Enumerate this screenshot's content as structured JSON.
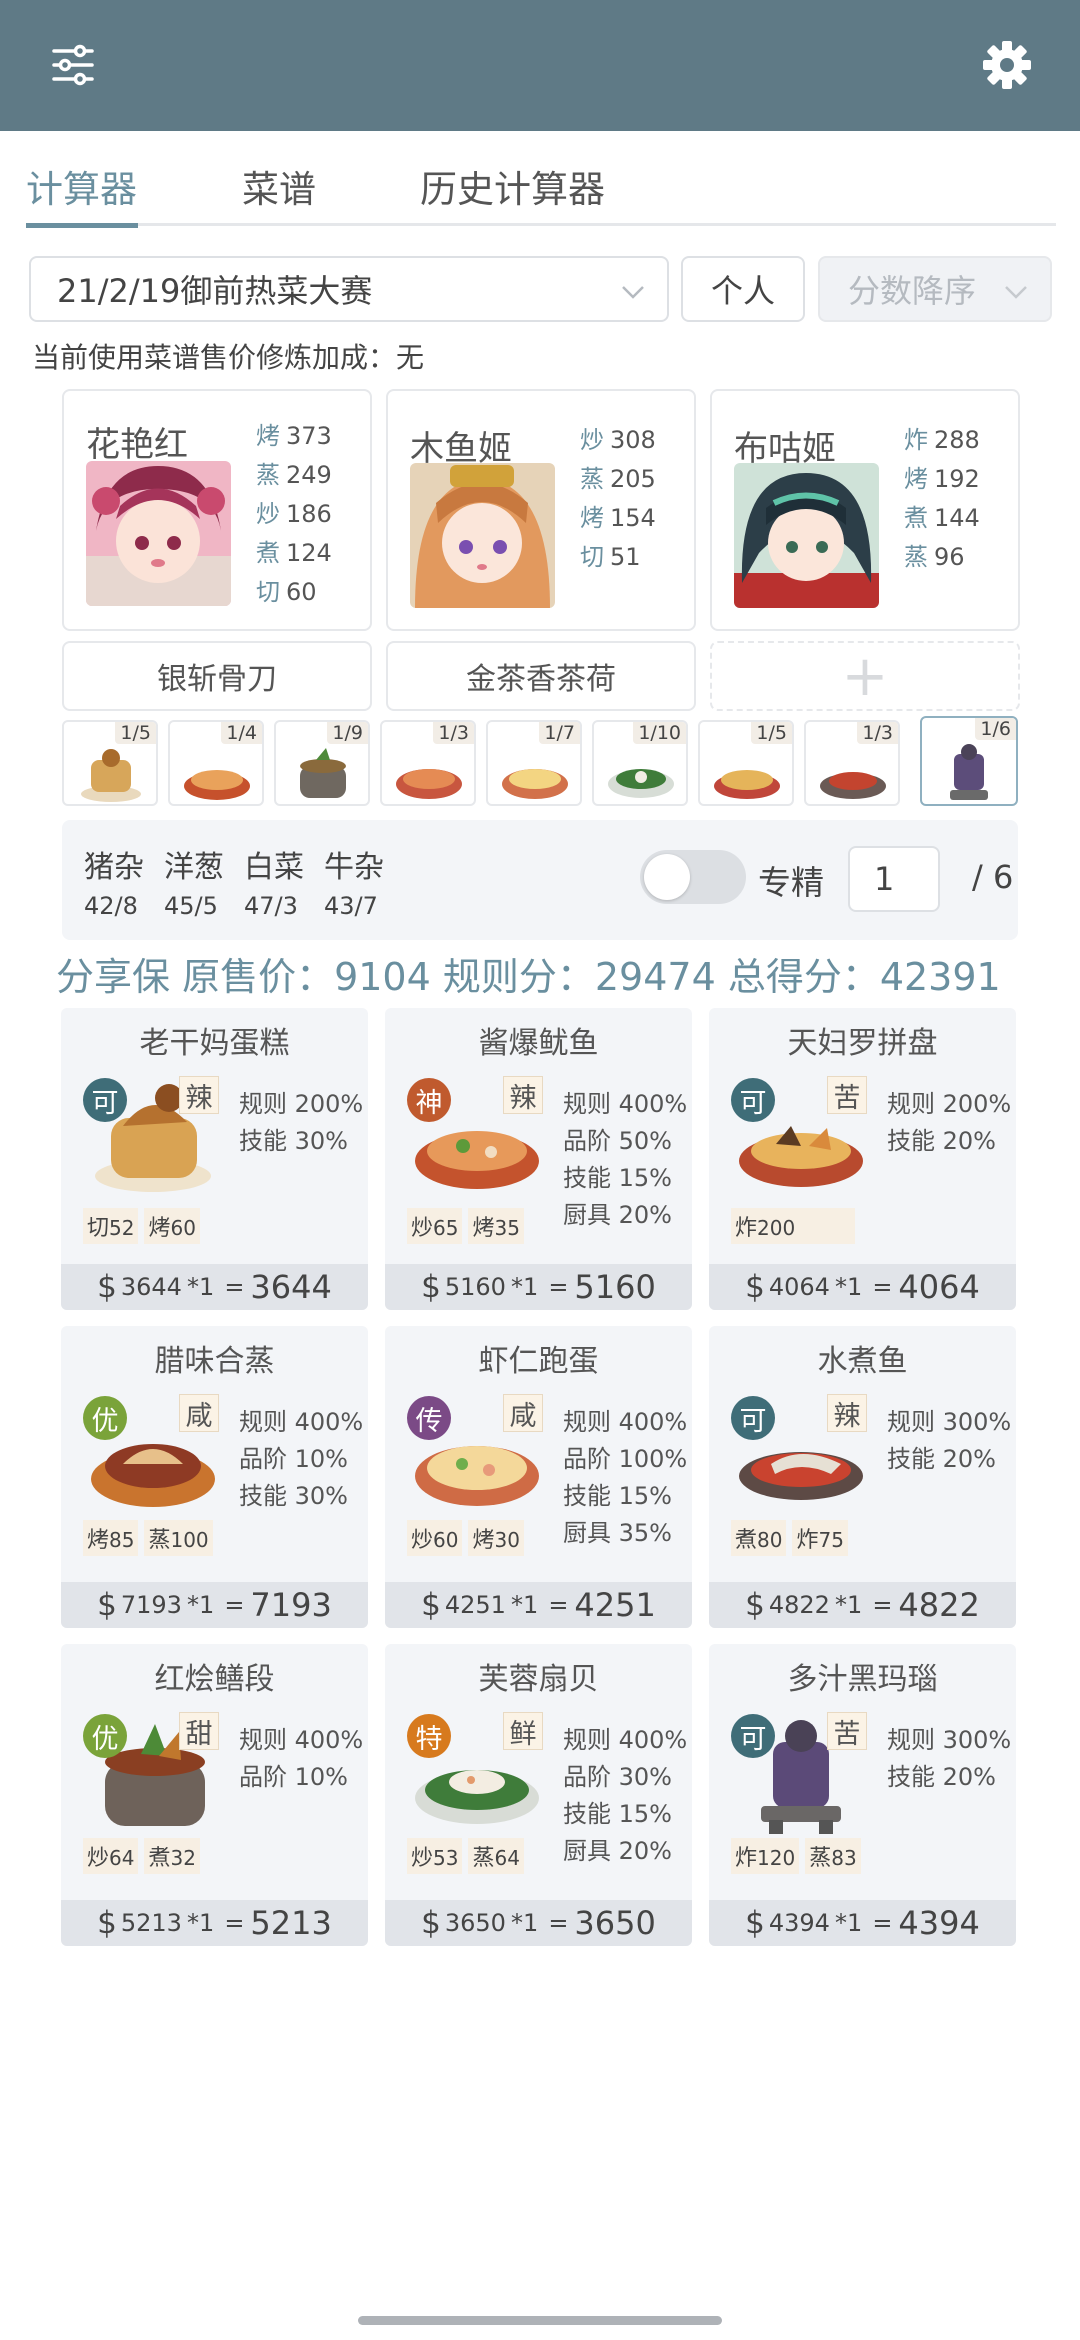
{
  "header": {
    "filter_icon": "sliders-icon",
    "settings_icon": "gear-icon",
    "bar_color": "#5f7a86"
  },
  "tabs": [
    {
      "label": "计算器",
      "active": true
    },
    {
      "label": "菜谱",
      "active": false
    },
    {
      "label": "历史计算器",
      "active": false
    }
  ],
  "controls": {
    "contest": "21/2/19御前热菜大赛",
    "mode": "个人",
    "sort": "分数降序"
  },
  "bonus_line": "当前使用菜谱售价修炼加成：无",
  "chefs": [
    {
      "name": "花艳红",
      "skills": [
        {
          "k": "烤",
          "v": "373"
        },
        {
          "k": "蒸",
          "v": "249"
        },
        {
          "k": "炒",
          "v": "186"
        },
        {
          "k": "煮",
          "v": "124"
        },
        {
          "k": "切",
          "v": "60"
        }
      ]
    },
    {
      "name": "木鱼姬",
      "skills": [
        {
          "k": "炒",
          "v": "308"
        },
        {
          "k": "蒸",
          "v": "205"
        },
        {
          "k": "烤",
          "v": "154"
        },
        {
          "k": "切",
          "v": "51"
        }
      ]
    },
    {
      "name": "布咕姬",
      "skills": [
        {
          "k": "炸",
          "v": "288"
        },
        {
          "k": "烤",
          "v": "192"
        },
        {
          "k": "煮",
          "v": "144"
        },
        {
          "k": "蒸",
          "v": "96"
        }
      ]
    }
  ],
  "equipment": [
    "银斩骨刀",
    "金茶香茶荷",
    "+"
  ],
  "thumb_counts": [
    "1/5",
    "1/4",
    "1/9",
    "1/3",
    "1/7",
    "1/10",
    "1/5",
    "1/3",
    "1/6"
  ],
  "ingredients": [
    {
      "name": "猪杂",
      "value": "42/8"
    },
    {
      "name": "洋葱",
      "value": "45/5"
    },
    {
      "name": "白菜",
      "value": "47/3"
    },
    {
      "name": "牛杂",
      "value": "43/7"
    }
  ],
  "specialize": {
    "label": "专精",
    "qty": "1",
    "max": "/ 6",
    "on": false
  },
  "score_line": "分享保 原售价：9104 规则分：29474 总得分：42391",
  "dishes": [
    {
      "name": "老干妈蛋糕",
      "rarity": "可",
      "rarity_color": "#3f6d78",
      "flavor": "辣",
      "bonuses": [
        "规则 200%",
        "技能 30%"
      ],
      "reqs": [
        {
          "k": "切",
          "v": "52"
        },
        {
          "k": "烤",
          "v": "60"
        }
      ],
      "price": "3644",
      "mult": "*1",
      "total": "3644"
    },
    {
      "name": "酱爆鱿鱼",
      "rarity": "神",
      "rarity_color": "#c05a2e",
      "flavor": "辣",
      "bonuses": [
        "规则 400%",
        "品阶 50%",
        "技能 15%",
        "厨具 20%"
      ],
      "reqs": [
        {
          "k": "炒",
          "v": "65"
        },
        {
          "k": "烤",
          "v": "35"
        }
      ],
      "price": "5160",
      "mult": "*1",
      "total": "5160"
    },
    {
      "name": "天妇罗拼盘",
      "rarity": "可",
      "rarity_color": "#3f6d78",
      "flavor": "苦",
      "bonuses": [
        "规则 200%",
        "技能 20%"
      ],
      "reqs": [
        {
          "k": "炸",
          "v": "200"
        }
      ],
      "price": "4064",
      "mult": "*1",
      "total": "4064"
    },
    {
      "name": "腊味合蒸",
      "rarity": "优",
      "rarity_color": "#7aa33a",
      "flavor": "咸",
      "bonuses": [
        "规则 400%",
        "品阶 10%",
        "技能 30%"
      ],
      "reqs": [
        {
          "k": "烤",
          "v": "85"
        },
        {
          "k": "蒸",
          "v": "100"
        }
      ],
      "price": "7193",
      "mult": "*1",
      "total": "7193"
    },
    {
      "name": "虾仁跑蛋",
      "rarity": "传",
      "rarity_color": "#7b4a86",
      "flavor": "咸",
      "bonuses": [
        "规则 400%",
        "品阶 100%",
        "技能 15%",
        "厨具 35%"
      ],
      "reqs": [
        {
          "k": "炒",
          "v": "60"
        },
        {
          "k": "烤",
          "v": "30"
        }
      ],
      "price": "4251",
      "mult": "*1",
      "total": "4251"
    },
    {
      "name": "水煮鱼",
      "rarity": "可",
      "rarity_color": "#3f6d78",
      "flavor": "辣",
      "bonuses": [
        "规则 300%",
        "技能 20%"
      ],
      "reqs": [
        {
          "k": "煮",
          "v": "80"
        },
        {
          "k": "炸",
          "v": "75"
        }
      ],
      "price": "4822",
      "mult": "*1",
      "total": "4822"
    },
    {
      "name": "红烩鳝段",
      "rarity": "优",
      "rarity_color": "#7aa33a",
      "flavor": "甜",
      "bonuses": [
        "规则 400%",
        "品阶 10%"
      ],
      "reqs": [
        {
          "k": "炒",
          "v": "64"
        },
        {
          "k": "煮",
          "v": "32"
        }
      ],
      "price": "5213",
      "mult": "*1",
      "total": "5213"
    },
    {
      "name": "芙蓉扇贝",
      "rarity": "特",
      "rarity_color": "#d77a1e",
      "flavor": "鲜",
      "bonuses": [
        "规则 400%",
        "品阶 30%",
        "技能 15%",
        "厨具 20%"
      ],
      "reqs": [
        {
          "k": "炒",
          "v": "53"
        },
        {
          "k": "蒸",
          "v": "64"
        }
      ],
      "price": "3650",
      "mult": "*1",
      "total": "3650"
    },
    {
      "name": "多汁黑玛瑙",
      "rarity": "可",
      "rarity_color": "#3f6d78",
      "flavor": "苦",
      "bonuses": [
        "规则 300%",
        "技能 20%"
      ],
      "reqs": [
        {
          "k": "炸",
          "v": "120"
        },
        {
          "k": "蒸",
          "v": "83"
        }
      ],
      "price": "4394",
      "mult": "*1",
      "total": "4394"
    }
  ]
}
